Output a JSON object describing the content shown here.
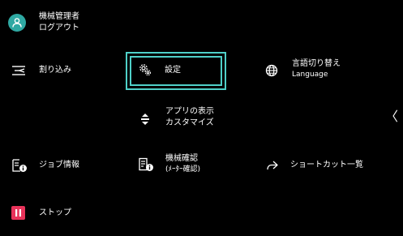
{
  "colors": {
    "background": "#000000",
    "text": "#ffffff",
    "focus": "#4fd0c8",
    "avatar": "#2fa9a3",
    "stop": "#e8335a"
  },
  "user": {
    "icon": "user-icon",
    "line1": "機械管理者",
    "line2": "ログアウト"
  },
  "menu": {
    "interrupt": {
      "icon": "interrupt-icon",
      "label": "割り込み"
    },
    "settings": {
      "icon": "gear-icon",
      "label": "設定"
    },
    "language": {
      "icon": "globe-icon",
      "line1": "言語切り替え",
      "line2": "Language"
    },
    "customize": {
      "icon": "sort-arrows-icon",
      "line1": "アプリの表示",
      "line2": "カスタマイズ"
    },
    "job_info": {
      "icon": "job-info-icon",
      "label": "ジョブ情報"
    },
    "machine_check": {
      "icon": "machine-info-icon",
      "line1": "機械確認",
      "line2": "(ﾒｰﾀｰ確認)"
    },
    "shortcuts": {
      "icon": "share-arrow-icon",
      "label": "ショートカット一覧"
    },
    "stop": {
      "icon": "pause-icon",
      "label": "ストップ"
    }
  },
  "nav": {
    "collapse_icon": "chevron-left-icon",
    "glyph": "〈"
  }
}
